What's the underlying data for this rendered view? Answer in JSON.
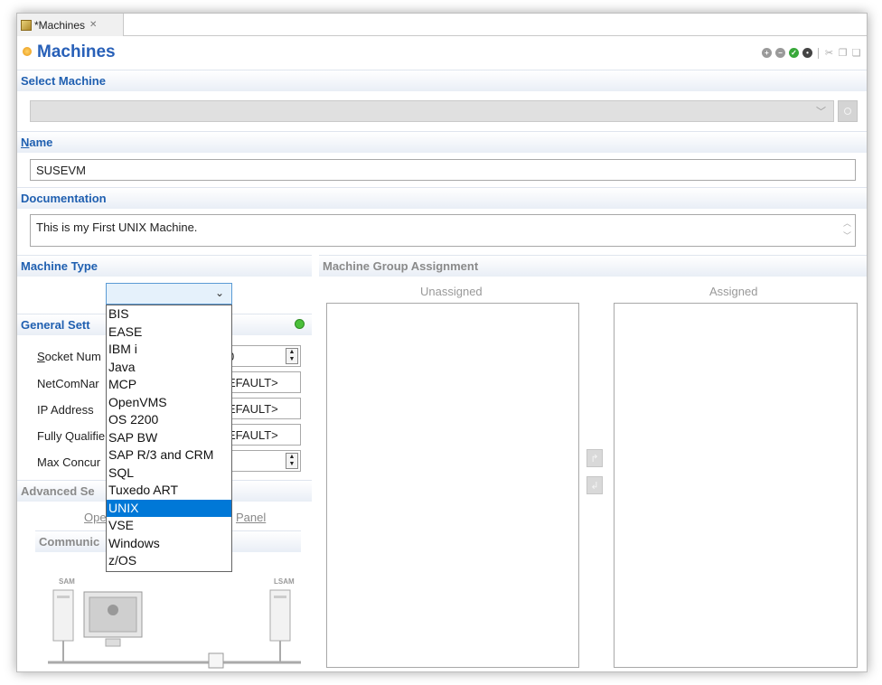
{
  "tab": {
    "label": "*Machines",
    "close": "✕"
  },
  "header": {
    "title": "Machines"
  },
  "sections": {
    "select_machine": "Select Machine",
    "name_accel": "N",
    "name_rest": "ame",
    "documentation": "Documentation",
    "machine_type": "Machine Type",
    "machine_group": "Machine Group Assignment",
    "general_settings": "General Sett",
    "advanced_settings": "Advanced Se",
    "communications": "Communic"
  },
  "fields": {
    "name_value": "SUSEVM",
    "documentation_value": "This is my First UNIX Machine.",
    "machine_type_value": ""
  },
  "general": {
    "socket_label_accel": "S",
    "socket_label_rest": "ocket Num",
    "socket_value": "0",
    "netcom_label": "NetComNar",
    "netcom_value": "EFAULT>",
    "ip_label": "IP Address",
    "ip_value": "EFAULT>",
    "fq_label": "Fully Qualifie",
    "fq_value": "EFAULT>",
    "maxconc_label": "Max Concur",
    "maxconc_value": ""
  },
  "advanced": {
    "open_link": "Ope",
    "panel_link": "Panel"
  },
  "group_assignment": {
    "unassigned": "Unassigned",
    "assigned": "Assigned"
  },
  "diagram": {
    "sam": "SAM",
    "lsam": "LSAM"
  },
  "dropdown_options": [
    "BIS",
    "EASE",
    "IBM i",
    "Java",
    "MCP",
    "OpenVMS",
    "OS 2200",
    "SAP BW",
    "SAP R/3 and CRM",
    "SQL",
    "Tuxedo ART",
    "UNIX",
    "VSE",
    "Windows",
    "z/OS"
  ],
  "dropdown_selected": "UNIX",
  "colors": {
    "accent": "#1f5fb0",
    "selection": "#0078d7"
  }
}
